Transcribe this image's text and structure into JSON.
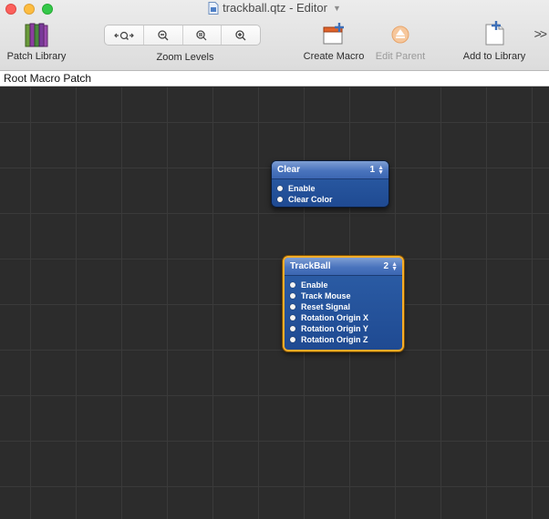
{
  "window": {
    "title": "trackball.qtz - Editor"
  },
  "toolbar": {
    "patch_library_label": "Patch Library",
    "zoom_levels_label": "Zoom Levels",
    "create_macro_label": "Create Macro",
    "edit_parent_label": "Edit Parent",
    "add_to_library_label": "Add to Library",
    "more_label": ">>"
  },
  "path_bar": {
    "text": "Root Macro Patch"
  },
  "patches": {
    "clear": {
      "title": "Clear",
      "number": "1",
      "ports": [
        "Enable",
        "Clear Color"
      ]
    },
    "trackball": {
      "title": "TrackBall",
      "number": "2",
      "ports": [
        "Enable",
        "Track Mouse",
        "Reset Signal",
        "Rotation Origin X",
        "Rotation Origin Y",
        "Rotation Origin Z"
      ]
    }
  },
  "colors": {
    "canvas_bg": "#2c2c2c",
    "patch_blue": "#2d5fa8",
    "selection_orange": "#f5ad2a"
  }
}
